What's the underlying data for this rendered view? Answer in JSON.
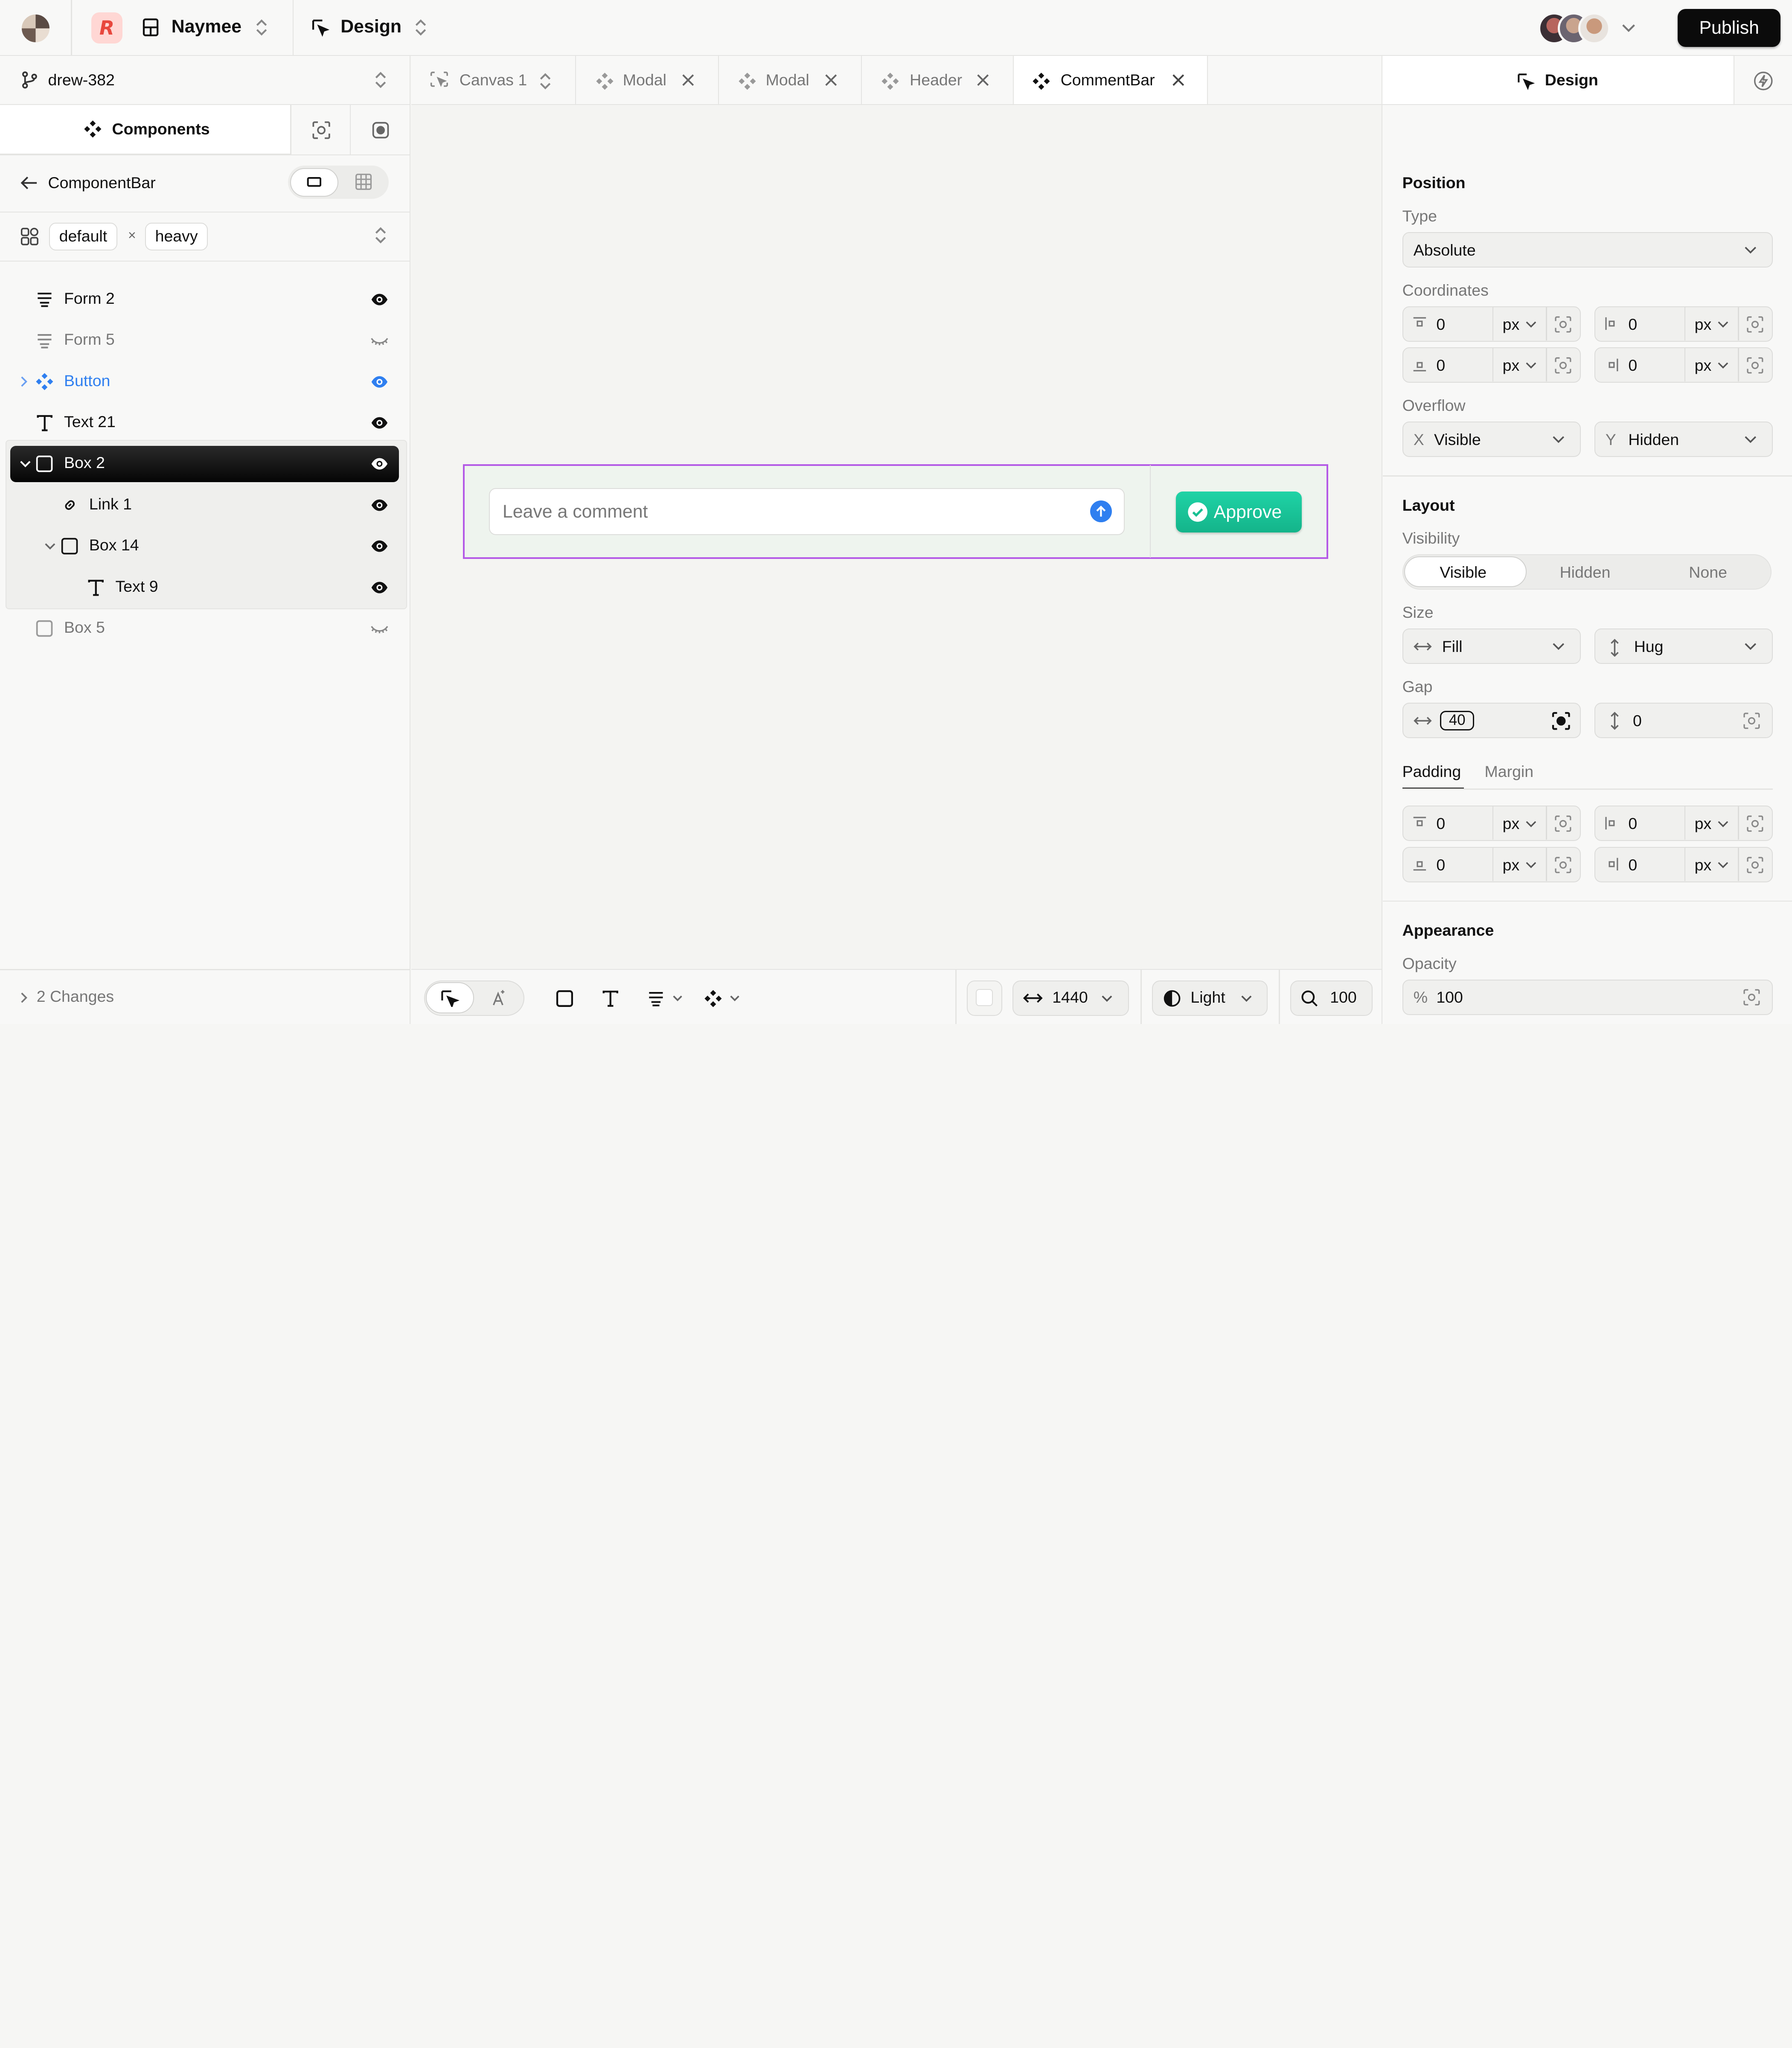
{
  "app": {
    "project_name": "Naymee",
    "mode_label": "Design",
    "publish_label": "Publish",
    "colors": {
      "accent_blue": "#2f7ff0",
      "approve_green": "#17c497",
      "frame_purple": "#b45ae6"
    }
  },
  "left": {
    "branch": "drew-382",
    "panel_tab": "Components",
    "component_name": "ComponentBar",
    "variants": [
      "default",
      "heavy"
    ],
    "variant_separator": "×",
    "layers": [
      {
        "label": "Form 2",
        "icon": "form-icon",
        "visible": true
      },
      {
        "label": "Form 5",
        "icon": "form-icon",
        "visible": false
      },
      {
        "label": "Button",
        "icon": "component-icon",
        "visible": true
      },
      {
        "label": "Text 21",
        "icon": "text-icon",
        "visible": true
      },
      {
        "label": "Box 2",
        "icon": "box-icon",
        "visible": true,
        "selected": true
      },
      {
        "label": "Link 1",
        "icon": "link-icon",
        "visible": true
      },
      {
        "label": "Box 14",
        "icon": "box-icon",
        "visible": true
      },
      {
        "label": "Text 9",
        "icon": "text-icon",
        "visible": true
      },
      {
        "label": "Box 5",
        "icon": "box-icon",
        "visible": false
      }
    ],
    "changes_label": "2 Changes"
  },
  "tabs": [
    {
      "label": "Canvas 1",
      "icon": "canvas-icon",
      "active": false
    },
    {
      "label": "Modal",
      "icon": "component-icon",
      "active": false
    },
    {
      "label": "Modal",
      "icon": "component-icon",
      "active": false
    },
    {
      "label": "Header",
      "icon": "component-icon",
      "active": false
    },
    {
      "label": "CommentBar",
      "icon": "component-icon",
      "active": true
    }
  ],
  "canvas": {
    "comment_placeholder": "Leave a comment",
    "approve_label": "Approve"
  },
  "bottom": {
    "width_value": "1440",
    "theme_label": "Light",
    "zoom_value": "100"
  },
  "right": {
    "tab_label": "Design",
    "position": {
      "title": "Position",
      "type_label": "Type",
      "type_value": "Absolute",
      "coords_label": "Coordinates",
      "coords": [
        {
          "value": "0",
          "unit": "px"
        },
        {
          "value": "0",
          "unit": "px"
        },
        {
          "value": "0",
          "unit": "px"
        },
        {
          "value": "0",
          "unit": "px"
        }
      ],
      "overflow_label": "Overflow",
      "overflow_x_axis": "X",
      "overflow_x": "Visible",
      "overflow_y_axis": "Y",
      "overflow_y": "Hidden"
    },
    "layout": {
      "title": "Layout",
      "visibility_label": "Visibility",
      "visibility_options": [
        "Visible",
        "Hidden",
        "None"
      ],
      "visibility_selected": "Visible",
      "size_label": "Size",
      "size_w": "Fill",
      "size_h": "Hug",
      "gap_label": "Gap",
      "gap_h": "40",
      "gap_v": "0",
      "padding_tab": "Padding",
      "margin_tab": "Margin",
      "padding": [
        {
          "value": "0",
          "unit": "px"
        },
        {
          "value": "0",
          "unit": "px"
        },
        {
          "value": "0",
          "unit": "px"
        },
        {
          "value": "0",
          "unit": "px"
        }
      ]
    },
    "appearance": {
      "title": "Appearance",
      "opacity_label": "Opacity",
      "opacity_unit": "%",
      "opacity_value": "100"
    }
  }
}
